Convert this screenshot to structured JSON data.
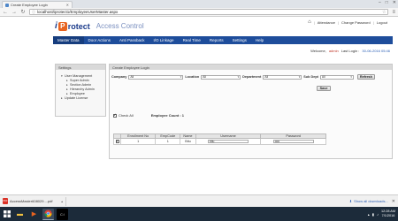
{
  "browser": {
    "tab_title": "Create Employee Login",
    "url": "localhost/iprotect1/EmployeeUserMaster.aspx",
    "window_controls": [
      "–",
      "□",
      "✕"
    ]
  },
  "header": {
    "logo_i": "i",
    "logo_p": "P",
    "logo_rest": "rotect",
    "logo_sub": "Access Control",
    "links": [
      "Attendance",
      "Change Password",
      "Logout"
    ],
    "separator": "|"
  },
  "nav": {
    "items": [
      "Master Data",
      "Door Actions",
      "Anti Passback",
      "I/O Linkage",
      "Real Time",
      "Reports",
      "Settings",
      "Help"
    ]
  },
  "welcome": {
    "prefix": "Welcome,",
    "user": "admin",
    "last_login_label": "Last Login :",
    "last_login": "30-06-2016 05:46"
  },
  "sidebar": {
    "title": "Settings",
    "items": [
      {
        "label": "User Management",
        "level": 1,
        "arrow": "▾"
      },
      {
        "label": "Super Admin",
        "level": 2,
        "arrow": "▸"
      },
      {
        "label": "Section Admin",
        "level": 2,
        "arrow": "▸"
      },
      {
        "label": "Hierarchy Admin",
        "level": 2,
        "arrow": "▸"
      },
      {
        "label": "Employee",
        "level": 2,
        "arrow": "▸"
      },
      {
        "label": "Update License",
        "level": 1,
        "arrow": "▸"
      }
    ]
  },
  "content": {
    "title": "Create Employee Login",
    "filters": {
      "company_label": "Company",
      "company_value": "All",
      "location_label": "Location",
      "location_value": "All",
      "department_label": "Department",
      "department_value": "All",
      "subdept_label": "Sub Dept",
      "subdept_value": "All",
      "refresh_label": "Refresh"
    },
    "save_label": "Save",
    "check_all_label": "Check All",
    "employee_count": "Employee Count : 1",
    "table": {
      "headers": [
        "",
        "Enrollment No",
        "EmpCode",
        "Name",
        "Username",
        "Password"
      ],
      "rows": [
        {
          "checked": "✔",
          "enrollment": "1",
          "empcode": "1",
          "name": "Bitu",
          "username": "bitu",
          "password": "••••••"
        }
      ]
    }
  },
  "download_shelf": {
    "filename": "AccessMaster608029....pdf",
    "file_type": "PDF",
    "show_all": "Show all downloads...",
    "close": "✕"
  },
  "taskbar": {
    "time": "12:28 AM",
    "date": "7/1/2016"
  },
  "colors": {
    "nav_bg": "#1e4d9b",
    "logo_orange": "#e8631f",
    "logo_blue": "#1a3a8a",
    "taskbar": "#1c2b3a"
  }
}
